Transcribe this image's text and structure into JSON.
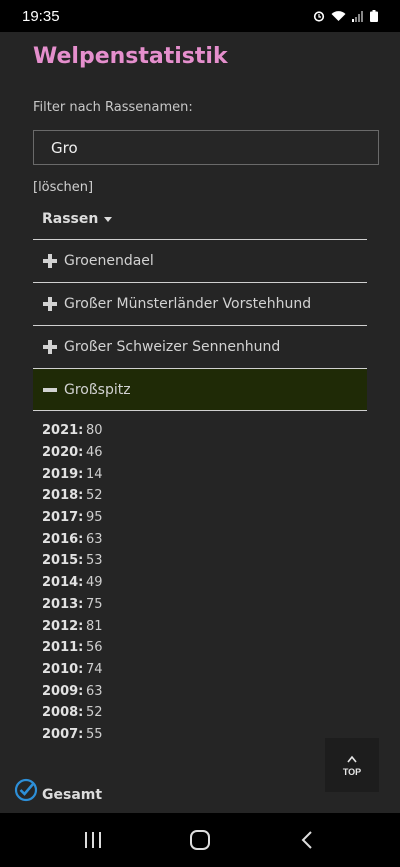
{
  "status_bar": {
    "time": "19:35"
  },
  "page": {
    "title": "Welpenstatistik",
    "filter_label": "Filter nach Rassenamen:",
    "filter_value": "Gro",
    "clear_label": "[löschen]",
    "breed_header": "Rassen",
    "breeds": [
      {
        "name": "Groenendael",
        "expanded": false
      },
      {
        "name": "Großer Münsterländer Vorstehhund",
        "expanded": false
      },
      {
        "name": "Großer Schweizer Sennenhund",
        "expanded": false
      },
      {
        "name": "Großspitz",
        "expanded": true
      }
    ],
    "stats": [
      {
        "year": "2021:",
        "value": "80"
      },
      {
        "year": "2020:",
        "value": "46"
      },
      {
        "year": "2019:",
        "value": "14"
      },
      {
        "year": "2018:",
        "value": "52"
      },
      {
        "year": "2017:",
        "value": "95"
      },
      {
        "year": "2016:",
        "value": "63"
      },
      {
        "year": "2015:",
        "value": "53"
      },
      {
        "year": "2014:",
        "value": "49"
      },
      {
        "year": "2013:",
        "value": "75"
      },
      {
        "year": "2012:",
        "value": "81"
      },
      {
        "year": "2011:",
        "value": "56"
      },
      {
        "year": "2010:",
        "value": "74"
      },
      {
        "year": "2009:",
        "value": "63"
      },
      {
        "year": "2008:",
        "value": "52"
      },
      {
        "year": "2007:",
        "value": "55"
      }
    ],
    "total_label": "Gesamt",
    "top_button_label": "TOP"
  },
  "colors": {
    "title": "#e58fcd",
    "active_row": "#1f2a06",
    "background": "#252525"
  }
}
